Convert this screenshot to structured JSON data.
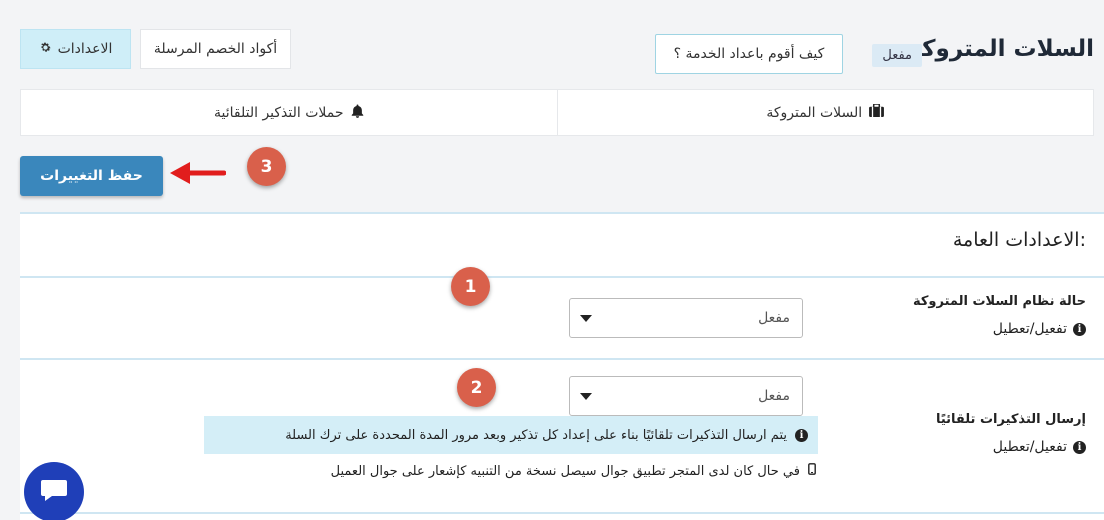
{
  "header": {
    "title": "السلات المتروكة",
    "status_badge": "مفعل",
    "howto_label": "كيف أقوم باعداد الخدمة ؟",
    "coupons_label": "أكواد الخصم المرسلة",
    "settings_label": "الاعدادات"
  },
  "tabs": [
    {
      "label": "السلات المتروكة",
      "icon": "briefcase-icon"
    },
    {
      "label": "حملات التذكير التلقائية",
      "icon": "bell-icon"
    }
  ],
  "toolbar": {
    "save_label": "حفظ التغييرات"
  },
  "steps": [
    "1",
    "2",
    "3"
  ],
  "general": {
    "title": "الاعدادات العامة:",
    "status_field": {
      "label": "حالة نظام السلات المتروكة",
      "hint": "تفعيل/تعطيل",
      "value": "مفعل"
    },
    "reminders_field": {
      "label": "إرسال التذكيرات تلقائيًا",
      "hint": "تفعيل/تعطيل",
      "value": "مفعل",
      "info": "يتم ارسال التذكيرات تلقائيًا بناء على إعداد كل تذكير وبعد مرور المدة المحددة على ترك السلة",
      "mobile_note": "في حال كان لدى المتجر تطبيق جوال سيصل نسخة من التنبيه كإشعار على جوال العميل"
    }
  },
  "colors": {
    "primary": "#3a87bc",
    "step_badge": "#d9604b",
    "arrow": "#e11d1d",
    "info_bg": "#d4eef7",
    "chat": "#1f3fb8"
  }
}
